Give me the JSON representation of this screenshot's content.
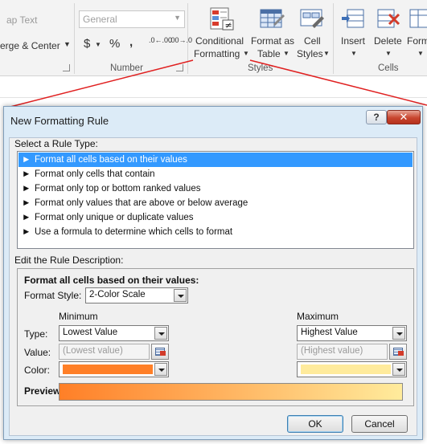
{
  "ribbon": {
    "wrap_text": "ap Text",
    "merge_center": "erge & Center",
    "number_format": "General",
    "currency_symbol": "$",
    "percent_symbol": "%",
    "comma_symbol": ",",
    "increase_decimal": ".0←.00",
    "decrease_decimal": ".00→.0",
    "number_group": "Number",
    "conditional_formatting_line1": "Conditional",
    "conditional_formatting_line2": "Formatting",
    "format_as_table_line1": "Format as",
    "format_as_table_line2": "Table",
    "cell_styles_line1": "Cell",
    "cell_styles_line2": "Styles",
    "styles_group": "Styles",
    "insert": "Insert",
    "delete": "Delete",
    "format": "Form",
    "cells_group": "Cells"
  },
  "dialog": {
    "title": "New Formatting Rule",
    "help": "?",
    "close": "✕",
    "select_rule_type_label": "Select a Rule Type:",
    "rule_types": [
      "Format all cells based on their values",
      "Format only cells that contain",
      "Format only top or bottom ranked values",
      "Format only values that are above or below average",
      "Format only unique or duplicate values",
      "Use a formula to determine which cells to format"
    ],
    "selected_rule_index": 0,
    "edit_description_label": "Edit the Rule Description:",
    "description_heading": "Format all cells based on their values:",
    "format_style_label": "Format Style:",
    "format_style_value": "2-Color Scale",
    "minimum_heading": "Minimum",
    "maximum_heading": "Maximum",
    "type_label": "Type:",
    "value_label": "Value:",
    "color_label": "Color:",
    "min_type": "Lowest Value",
    "max_type": "Highest Value",
    "min_value_placeholder": "(Lowest value)",
    "max_value_placeholder": "(Highest value)",
    "min_color": "#ff7f27",
    "max_color": "#ffeb9c",
    "preview_label": "Preview:",
    "ok": "OK",
    "cancel": "Cancel"
  },
  "colors": {
    "selection": "#3399ff",
    "callout_line": "#e02020"
  }
}
